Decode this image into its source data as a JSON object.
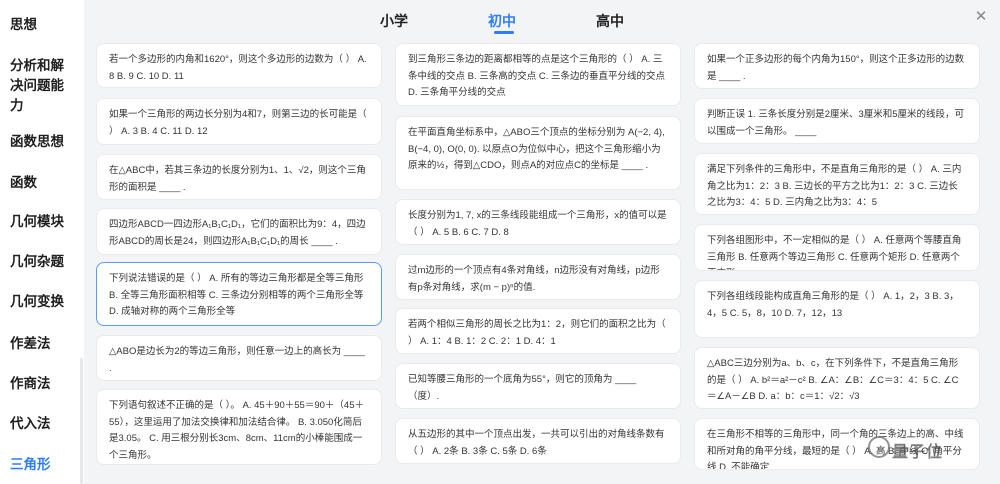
{
  "sidebar": {
    "items": [
      {
        "label": "思想"
      },
      {
        "label": "分析和解"
      },
      {
        "label": "决问题能"
      },
      {
        "label": "力"
      },
      {
        "label": "函数思想"
      },
      {
        "label": "函数"
      },
      {
        "label": "几何模块"
      },
      {
        "label": "几何杂题"
      },
      {
        "label": "几何变换"
      },
      {
        "label": "作差法"
      },
      {
        "label": "作商法"
      },
      {
        "label": "代入法"
      },
      {
        "label": "三角形"
      }
    ]
  },
  "tabs": [
    {
      "label": "小学"
    },
    {
      "label": "初中"
    },
    {
      "label": "高中"
    }
  ],
  "close_icon": "✕",
  "questions": {
    "col1": [
      "若一个多边形的内角和1620°，则这个多边形的边数为（ ） A. 8 B. 9 C. 10 D. 11",
      "如果一个三角形的两边长分别为4和7，则第三边的长可能是（ ） A. 3 B. 4 C. 11 D. 12",
      "在△ABC中，若其三条边的长度分别为1、1、√2，则这个三角形的面积是 ____ .",
      "四边形ABCD一四边形A₁B₁C₁D₁，它们的面积比为9：4，四边形ABCD的周长是24，则四边形A₁B₁C₁D₁的周长 ____ .",
      "下列说法错误的是（ ） A. 所有的等边三角形都是全等三角形 B. 全等三角形面积相等 C. 三条边分别相等的两个三角形全等 D. 成轴对称的两个三角形全等",
      "△ABO是边长为2的等边三角形，则任意一边上的高长为 ____ .",
      "下列语句叙述不正确的是（ ）。 A. 45＋90＋55＝90＋（45＋55），这里运用了加法交换律和加法结合律。 B. 3.050化简后是3.05。 C. 用三根分别长3cm、8cm、11cm的小棒能围成一个三角形。"
    ],
    "col2": [
      "到三角形三条边的距离都相等的点是这个三角形的（ ） A. 三条中线的交点 B. 三条高的交点 C. 三条边的垂直平分线的交点 D. 三条角平分线的交点",
      "在平面直角坐标系中，△ABO三个顶点的坐标分别为 A(−2, 4), B(−4, 0), O(0, 0). 以原点O为位似中心，把这个三角形缩小为原来的½，得到△CDO，则点A的对应点C的坐标是 ____ .",
      "长度分别为1, 7, x的三条线段能组成一个三角形，x的值可以是（ ） A. 5 B. 6 C. 7 D. 8",
      "过m边形的一个顶点有4条对角线，n边形没有对角线，p边形有p条对角线，求(m − p)ⁿ的值.",
      "若两个相似三角形的周长之比为1：2，则它们的面积之比为（ ） A. 1：4 B. 1：2 C. 2：1 D. 4：1",
      "已知等腰三角形的一个底角为55°，则它的顶角为 ____ （度）.",
      "从五边形的其中一个顶点出发，一共可以引出的对角线条数有（ ） A. 2条 B. 3条 C. 5条 D. 6条"
    ],
    "col3": [
      "如果一个正多边形的每个内角为150°，则这个正多边形的边数是 ____ .",
      "判断正误 1. 三条长度分别是2厘米、3厘米和5厘米的线段，可以围成一个三角形。 ____",
      "满足下列条件的三角形中，不是直角三角形的是（ ） A. 三内角之比为1：2：3 B. 三边长的平方之比为1：2：3 C. 三边长之比为3：4：5 D. 三内角之比为3：4：5",
      "下列各组图形中，不一定相似的是（ ） A. 任意两个等腰直角三角形 B. 任意两个等边三角形 C. 任意两个矩形 D. 任意两个正方形",
      "下列各组线段能构成直角三角形的是（ ） A. 1，2，3 B. 3，4，5 C. 5，8，10 D. 7，12，13",
      "△ABC三边分别为a、b、c，在下列条件下，不是直角三角形的是（ ） A. b²＝a²－c² B. ∠A：∠B：∠C＝3：4：5 C. ∠C＝∠A－∠B D. a：b：c＝1：√2：√3",
      "在三角形不相等的三角形中，同一个角的三条边上的高、中线和所对角的角平分线，最短的是（ ） A. 高 B. 中线 C. 角平分线 D. 不能确定"
    ]
  },
  "watermark": {
    "text": "量子位"
  }
}
